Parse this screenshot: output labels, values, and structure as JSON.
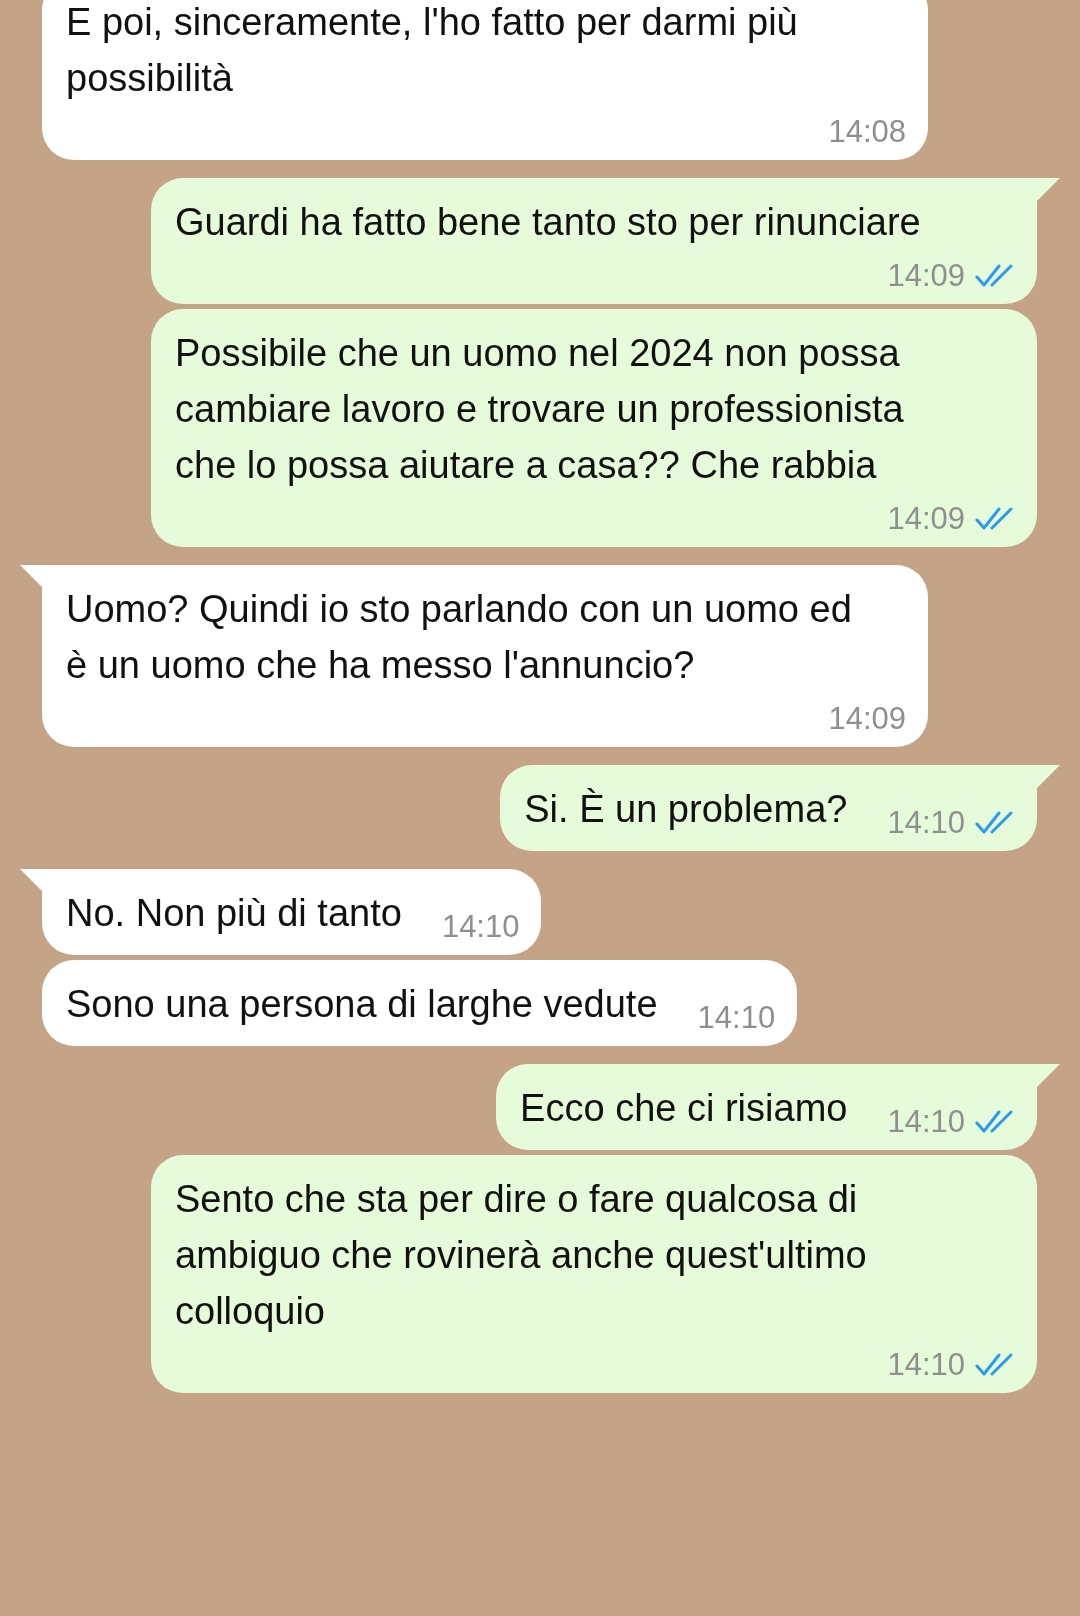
{
  "messages": [
    {
      "kind": "incoming",
      "tail": false,
      "text": "E poi, sinceramente, l'ho fatto per darmi più possibilità",
      "time": "14:08"
    },
    {
      "kind": "outgoing",
      "tail": true,
      "text": "Guardi ha fatto bene tanto sto per rinunciare",
      "time": "14:09",
      "read": true
    },
    {
      "kind": "outgoing",
      "tail": false,
      "text": "Possibile che un uomo nel 2024 non possa cambiare lavoro e trovare un professionista che lo possa aiutare a casa?? Che rabbia",
      "time": "14:09",
      "read": true
    },
    {
      "kind": "incoming",
      "tail": true,
      "text": "Uomo? Quindi io sto parlando con un uomo ed è un uomo che ha messo l'annuncio?",
      "time": "14:09"
    },
    {
      "kind": "outgoing",
      "tail": true,
      "text": "Si. È un problema?",
      "time": "14:10",
      "read": true
    },
    {
      "kind": "incoming",
      "tail": true,
      "text": "No. Non più di tanto",
      "time": "14:10"
    },
    {
      "kind": "incoming",
      "tail": false,
      "text": "Sono una persona di larghe vedute",
      "time": "14:10"
    },
    {
      "kind": "outgoing",
      "tail": true,
      "text": "Ecco che ci risiamo",
      "time": "14:10",
      "read": true
    },
    {
      "kind": "outgoing",
      "tail": false,
      "text": "Sento che sta per dire o fare qualcosa di ambiguo che rovinerà anche quest'ultimo colloquio",
      "time": "14:10",
      "read": true
    }
  ]
}
